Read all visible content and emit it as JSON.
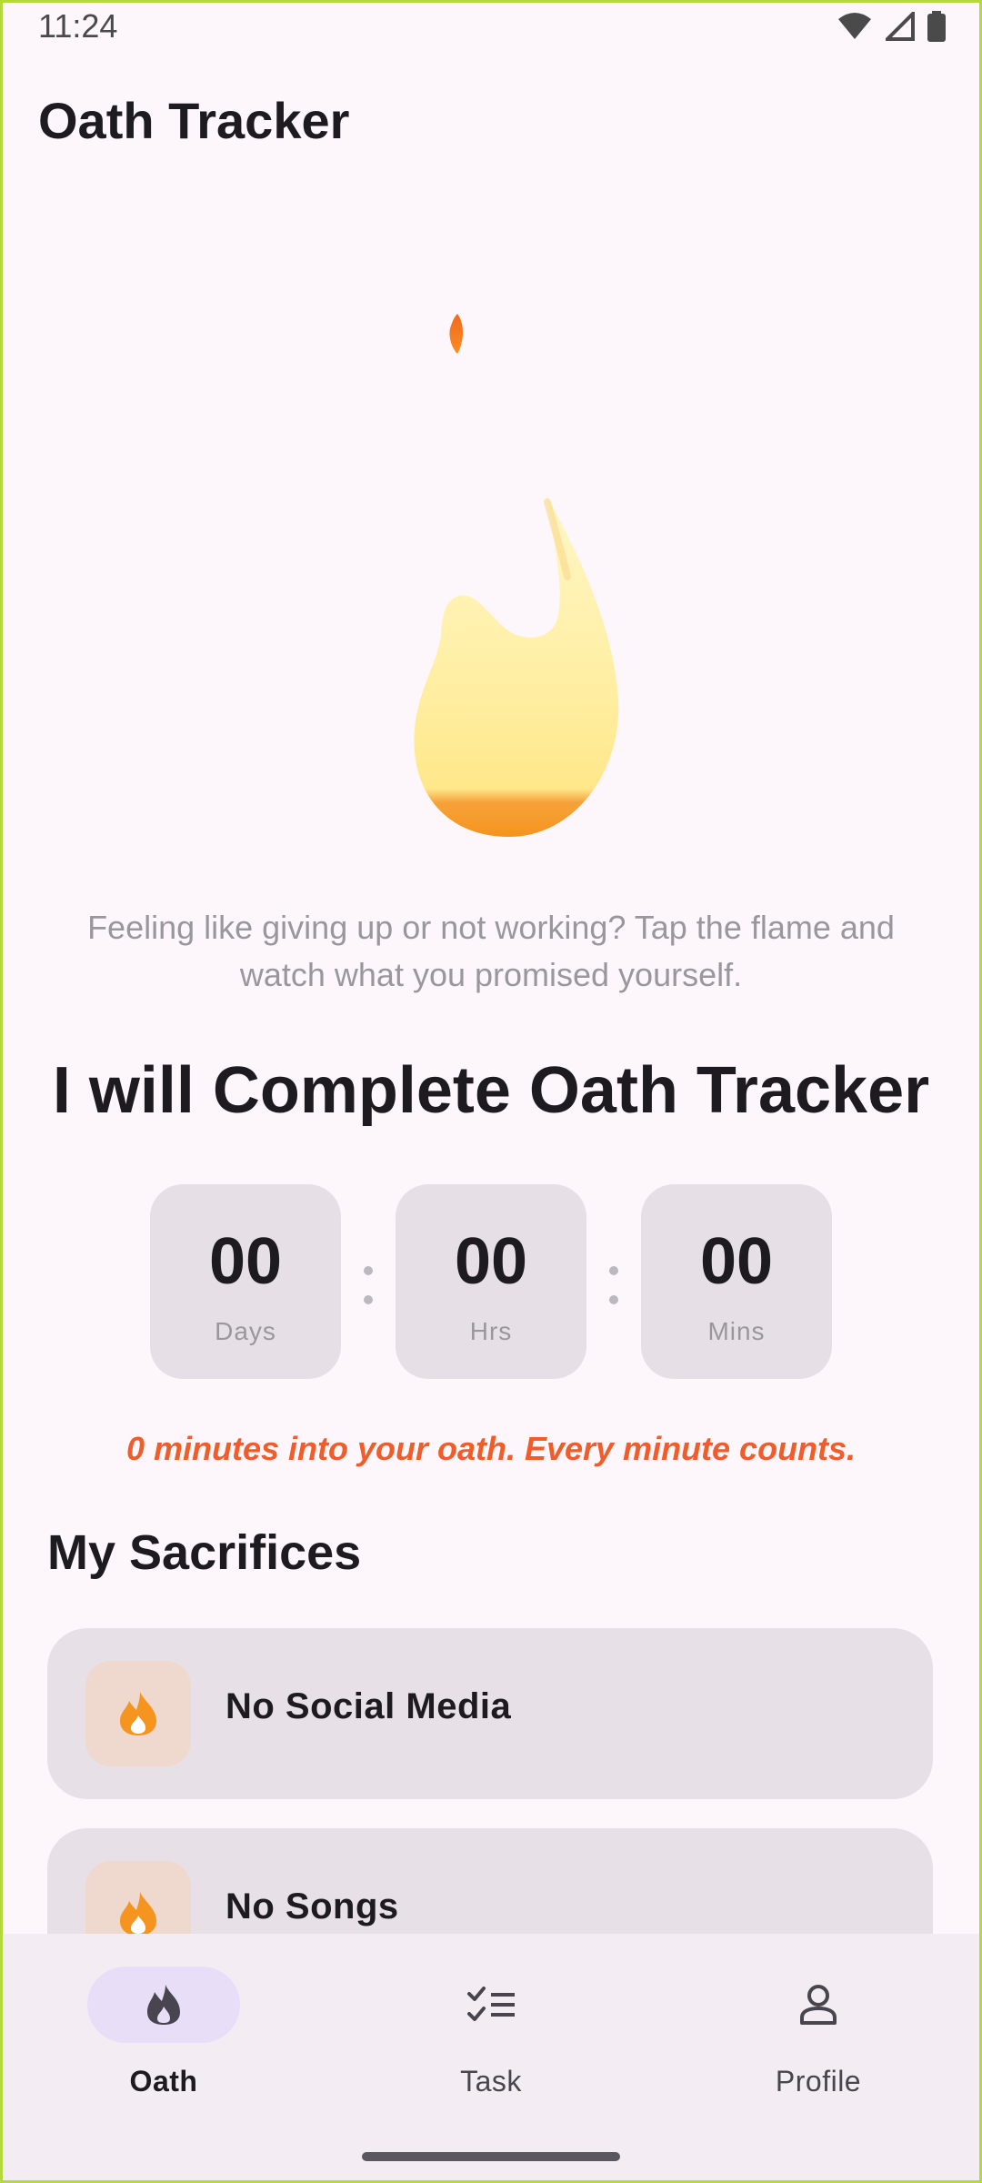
{
  "status_bar": {
    "time": "11:24"
  },
  "app": {
    "title": "Oath Tracker"
  },
  "hint": "Feeling like giving up or not working? Tap the flame and watch what you promised yourself.",
  "oath": {
    "title": "I will Complete Oath Tracker",
    "countdown": [
      {
        "value": "00",
        "unit": "Days"
      },
      {
        "value": "00",
        "unit": "Hrs"
      },
      {
        "value": "00",
        "unit": "Mins"
      }
    ],
    "message": "0 minutes into your oath. Every minute counts."
  },
  "sacrifices": {
    "title": "My Sacrifices",
    "items": [
      {
        "label": "No Social Media",
        "icon": "flame-icon"
      },
      {
        "label": "No Songs",
        "icon": "flame-icon"
      }
    ]
  },
  "bottom_nav": {
    "items": [
      {
        "label": "Oath",
        "icon": "flame-icon",
        "active": true
      },
      {
        "label": "Task",
        "icon": "checklist-icon",
        "active": false
      },
      {
        "label": "Profile",
        "icon": "person-icon",
        "active": false
      }
    ]
  },
  "colors": {
    "accent": "#f05d2a",
    "flame_orange": "#f5941e",
    "nav_active_pill": "#e8def8",
    "background": "#fdf7fb"
  }
}
